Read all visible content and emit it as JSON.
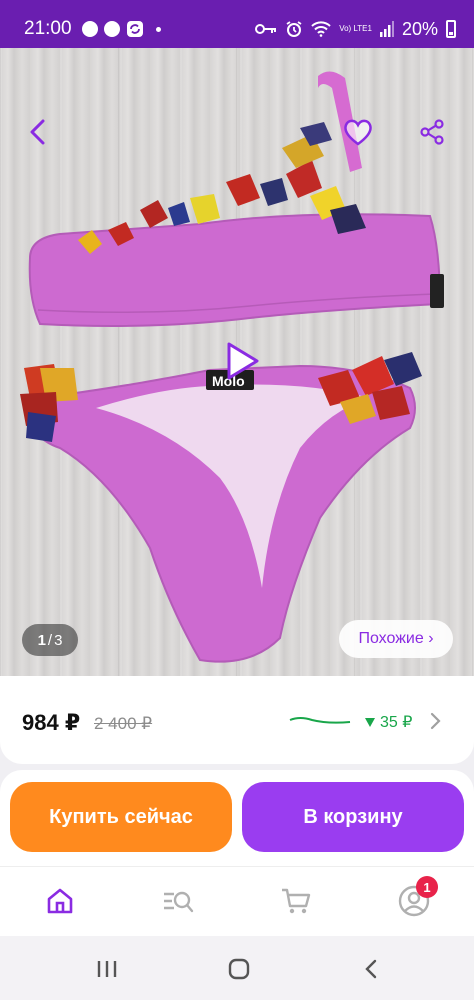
{
  "status_bar": {
    "time": "21:00",
    "battery": "20%",
    "network_label": "Vo) LTE1",
    "icons": [
      "circle",
      "circle",
      "sync-icon",
      "dot",
      "key-icon",
      "alarm-icon",
      "wifi-icon",
      "signal-icon",
      "battery-icon"
    ]
  },
  "photo": {
    "counter_current": "1",
    "counter_total": "3",
    "counter_sep": "/",
    "similar_label": "Похожие ›",
    "brand_tag": "Molo"
  },
  "price": {
    "current": "984 ₽",
    "old": "2 400 ₽",
    "drop": "35 ₽",
    "drop_color": "#19a64a"
  },
  "actions": {
    "buy_now": "Купить сейчас",
    "add_to_cart": "В корзину",
    "buy_color": "#ff8a1e",
    "cart_color": "#9a3df0"
  },
  "tab_bar": {
    "profile_badge": "1",
    "accent": "#8a2be2"
  },
  "colors": {
    "status_bar": "#6a1eb0",
    "accent": "#8a2be2"
  }
}
